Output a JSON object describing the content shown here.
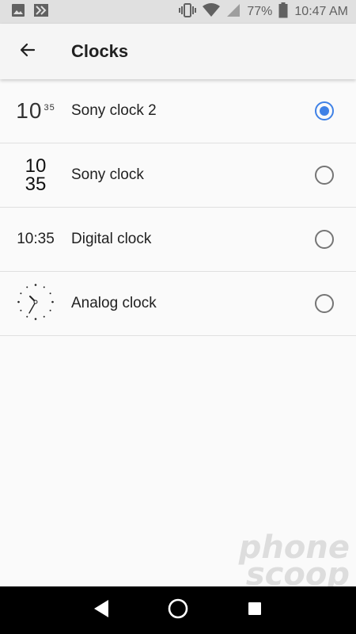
{
  "status_bar": {
    "battery_percent": "77%",
    "time": "10:47 AM",
    "icons": [
      "image-icon",
      "app-notification-icon",
      "vibrate-icon",
      "wifi-icon",
      "signal-icon",
      "battery-icon"
    ]
  },
  "app_bar": {
    "title": "Clocks",
    "back_icon": "arrow-back-icon"
  },
  "clocks": [
    {
      "label": "Sony clock 2",
      "preview_main": "10",
      "preview_small": "35",
      "selected": true
    },
    {
      "label": "Sony clock",
      "preview_top": "10",
      "preview_bottom": "35",
      "selected": false
    },
    {
      "label": "Digital clock",
      "preview_text": "10:35",
      "selected": false
    },
    {
      "label": "Analog clock",
      "preview_icon": "analog-clock-icon",
      "selected": false
    }
  ],
  "nav_bar": {
    "icons": [
      "back-triangle-icon",
      "home-circle-icon",
      "recents-square-icon"
    ]
  },
  "watermark": {
    "line1": "phone",
    "line2": "scoop"
  },
  "colors": {
    "accent": "#3f81e6",
    "status_bar_bg": "#e0e0e0",
    "app_bar_bg": "#f5f5f5",
    "nav_bar_bg": "#000000"
  }
}
